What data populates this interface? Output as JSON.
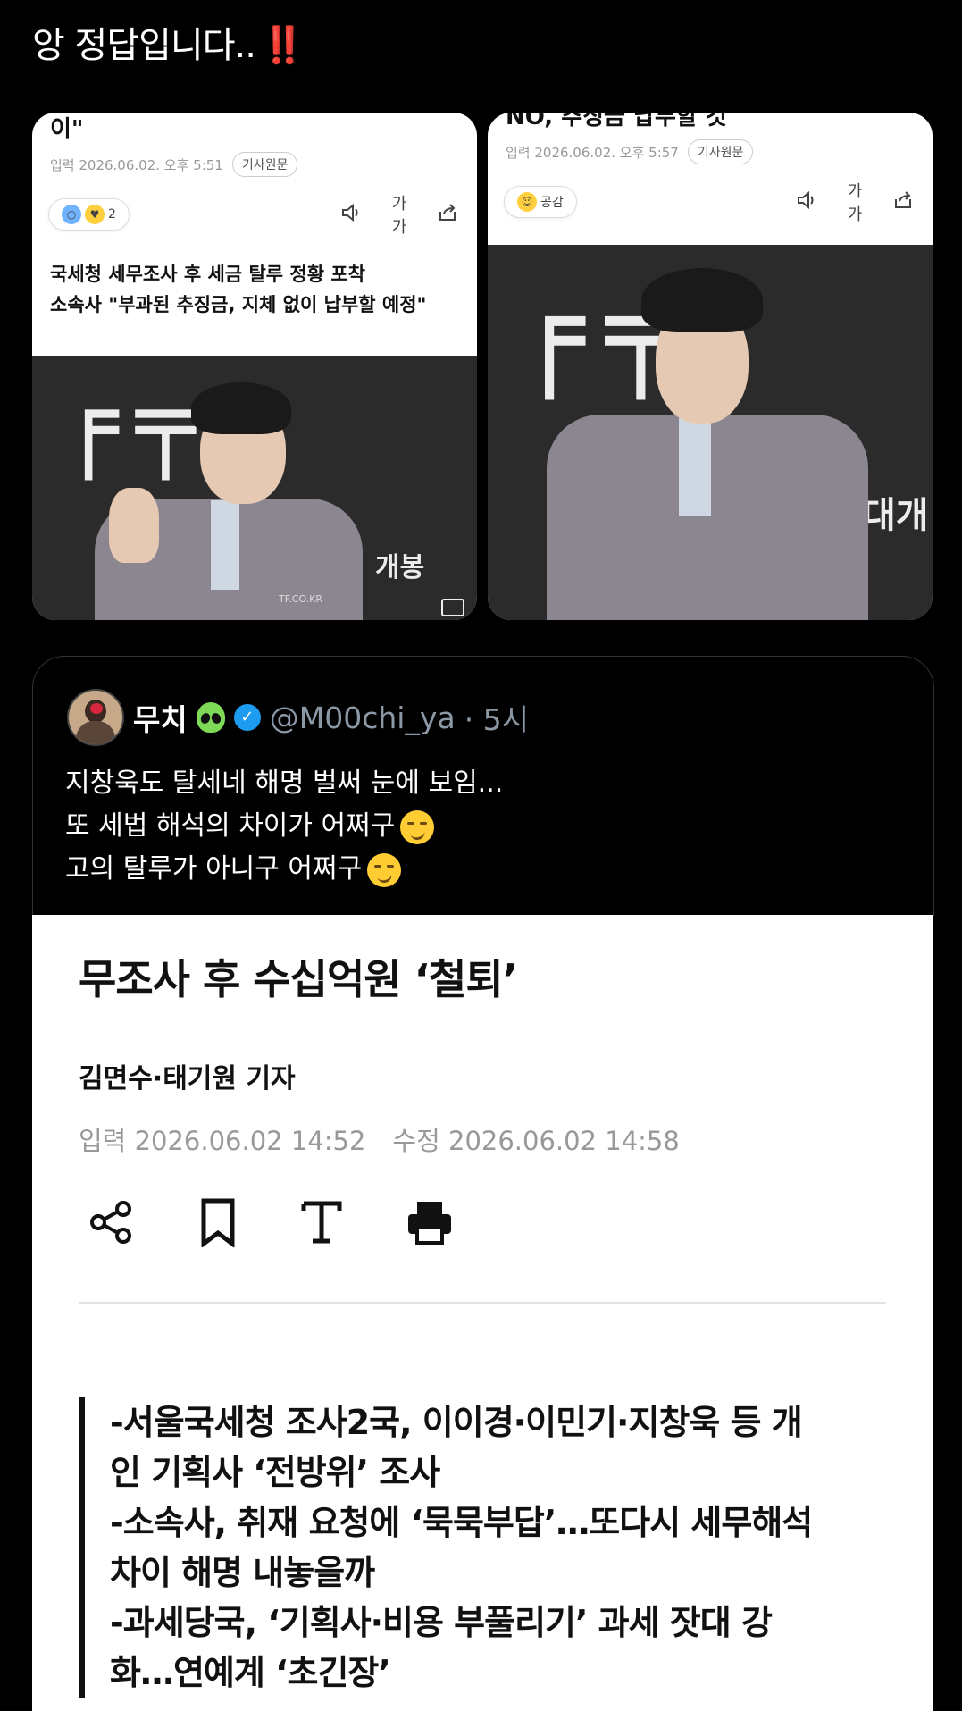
{
  "caption": {
    "text": "앙 정답입니다..",
    "emphasis": "‼️"
  },
  "news_left": {
    "cut_title": "이\"",
    "date": "입력 2026.06.02. 오후 5:51",
    "source_button": "기사원문",
    "reaction_count": "2",
    "font_tool": "가가",
    "headline_lines": [
      "국세청 세무조사 후 세금 탈루 정황 포착",
      "소속사 \"부과된 추징금, 지체 없이 납부할 예정\""
    ],
    "photo_watermark": "TF.CO.KR",
    "photo_sign_text": "개봉"
  },
  "news_right": {
    "cut_title": "NO, 추징금 납부할 것",
    "date": "입력 2026.06.02. 오후 5:57",
    "source_button": "기사원문",
    "reaction_label": "공감",
    "font_tool": "가가",
    "photo_sign_text": "대개"
  },
  "tweet": {
    "display_name": "무치",
    "handle": "@M00chi_ya",
    "time": "· 5시",
    "lines": [
      "지창욱도 탈세네 해명 벌써 눈에 보임...",
      "또 세법 해석의 차이가 어쩌구",
      "고의 탈루가 아니구 어쩌구"
    ]
  },
  "article": {
    "title": "무조사 후 수십억원 ‘철퇴’",
    "byline": "김면수·태기원 기자",
    "input_date": "입력 2026.06.02 14:52",
    "edit_date": "수정 2026.06.02 14:58",
    "summary": [
      "-서울국세청 조사2국, 이이경·이민기·지창욱 등 개\n인 기획사 ‘전방위’ 조사",
      "-소속사, 취재 요청에 ‘묵묵부답’…또다시 세무해석\n차이 해명 내놓을까",
      "-과세당국, ‘기획사·비용 부풀리기’ 과세 잣대 강\n화…연예계 ‘초긴장’"
    ]
  },
  "icons": [
    "volume-icon",
    "share-icon",
    "bookmark-icon",
    "text-size-icon",
    "print-icon",
    "verified-icon",
    "alien-emoji-icon",
    "smirk-emoji-icon"
  ]
}
